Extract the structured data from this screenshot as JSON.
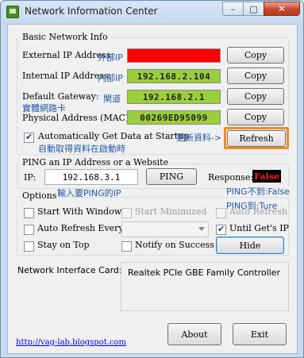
{
  "window": {
    "title": "Network Information Center",
    "minimize_label": "–",
    "maximize_label": "□",
    "close_label": "✕"
  },
  "basic": {
    "group_title": "Basic Network Info",
    "external_ip_label": "External IP Address:",
    "internal_ip_label": "Internal IP Address:",
    "gateway_label": "Default Gateway:",
    "mac_label": "Physical Address (MAC):",
    "external_ip_value": "",
    "internal_ip_value": "192.168.2.104",
    "gateway_value": "192.168.2.1",
    "mac_value": "00269ED95099",
    "copy_label": "Copy",
    "auto_get_label": "Automatically Get Data at Startup",
    "auto_get_checked": true,
    "refresh_label": "Refresh"
  },
  "annotations": {
    "external_ip": "外部IP",
    "internal_ip": "內部IP",
    "gateway": "閘道",
    "mac": "實體網路卡",
    "refresh": "更新資料->",
    "auto_get": "自動取得資料在啟動時",
    "ping_input": "輸入要PING的IP",
    "ping_false": "PING不到:False",
    "ping_true": "PING到:Ture"
  },
  "ping": {
    "group_title": "PING an IP Address or a Website",
    "ip_label": "IP:",
    "ip_value": "192.168.3.1",
    "button_label": "PING",
    "response_label": "Response:",
    "response_value": "False"
  },
  "options": {
    "group_title": "Options",
    "start_with_windows": "Start With Windows",
    "start_minimized": "Start Minimized",
    "auto_refresh": "Auto Refresh",
    "auto_refresh_every": "Auto Refresh Every:",
    "until_gets_ip": "Until Get's IP",
    "stay_on_top": "Stay on Top",
    "notify_on_success": "Notify on Success",
    "hide_label": "Hide",
    "until_gets_ip_checked": true
  },
  "nic": {
    "label": "Network Interface Card:",
    "value": "Realtek PCIe GBE Family Controller"
  },
  "footer": {
    "link": "http://vag-lab.blogspot.com",
    "about_label": "About",
    "exit_label": "Exit"
  },
  "colors": {
    "value_green": "#9ace3c",
    "external_ip_red": "#ff0000",
    "refresh_highlight": "#f08a24",
    "annotation_blue": "#2358a6",
    "response_red": "#ff1f1f"
  }
}
